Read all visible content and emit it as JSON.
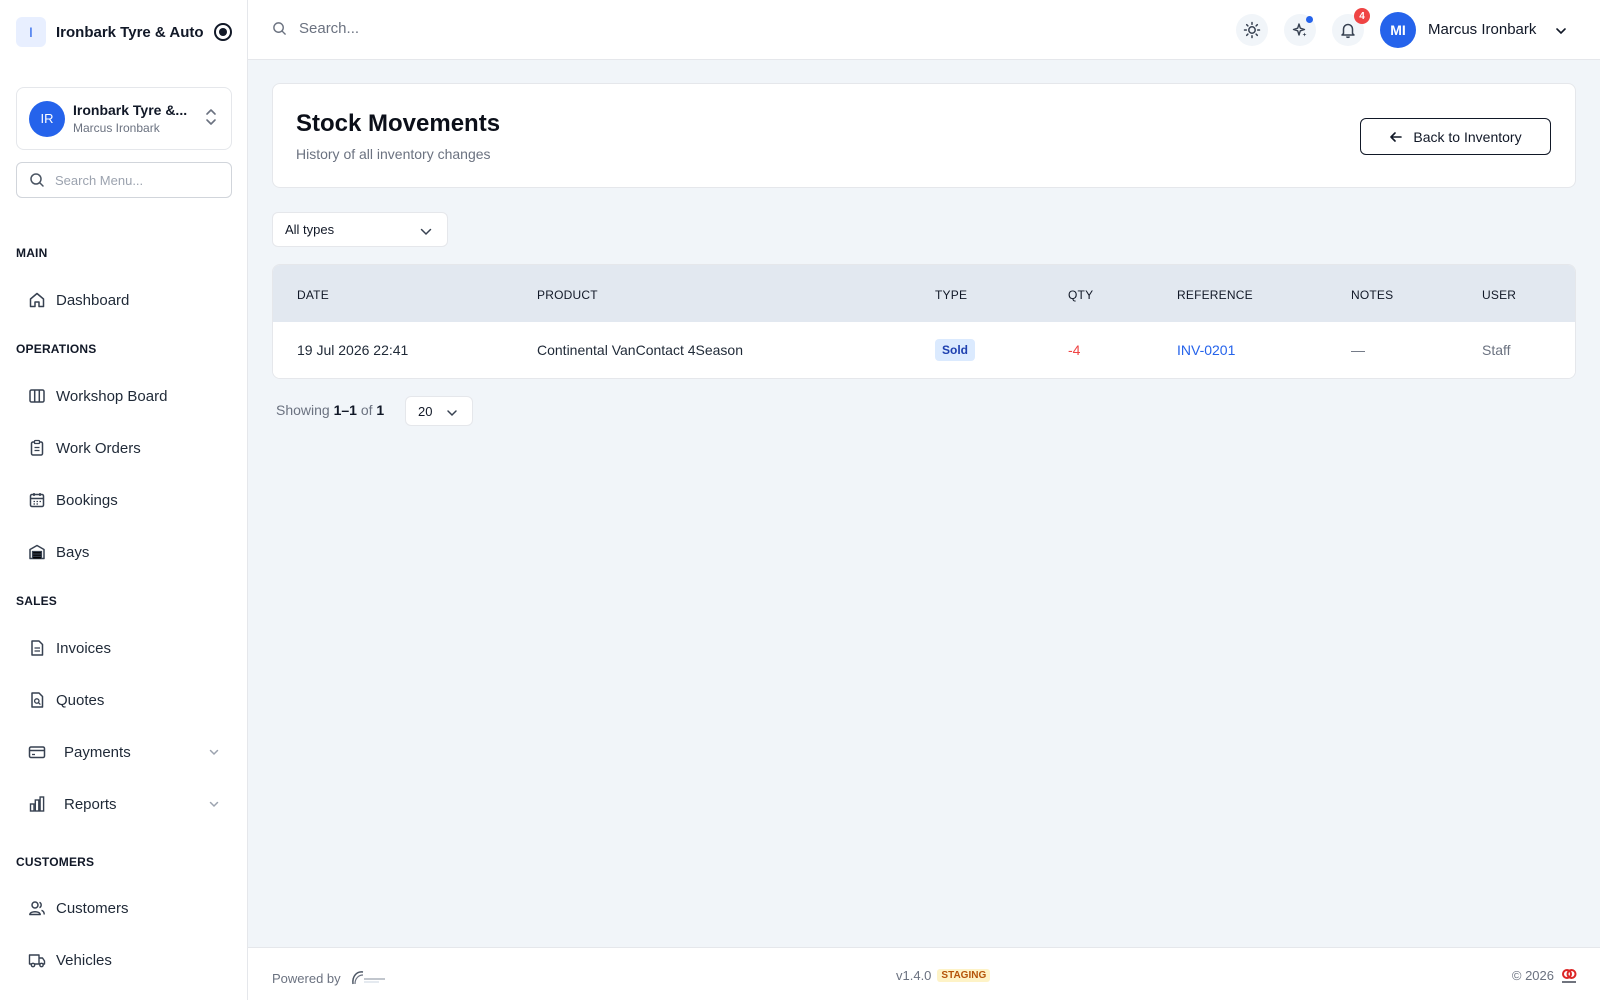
{
  "brand": {
    "logo_letter": "I",
    "name": "Ironbark Tyre & Auto"
  },
  "org": {
    "initials": "IR",
    "name": "Ironbark Tyre &...",
    "user": "Marcus Ironbark"
  },
  "menu_search": {
    "placeholder": "Search Menu..."
  },
  "sidebar": {
    "sections": [
      {
        "label": "MAIN",
        "items": [
          {
            "label": "Dashboard",
            "icon": "home-icon"
          }
        ]
      },
      {
        "label": "OPERATIONS",
        "items": [
          {
            "label": "Workshop Board",
            "icon": "columns-icon"
          },
          {
            "label": "Work Orders",
            "icon": "clipboard-icon"
          },
          {
            "label": "Bookings",
            "icon": "calendar-icon"
          },
          {
            "label": "Bays",
            "icon": "garage-icon"
          }
        ]
      },
      {
        "label": "SALES",
        "items": [
          {
            "label": "Invoices",
            "icon": "document-icon"
          },
          {
            "label": "Quotes",
            "icon": "document-search-icon"
          },
          {
            "label": "Payments",
            "icon": "credit-card-icon",
            "expandable": true
          },
          {
            "label": "Reports",
            "icon": "bar-chart-icon",
            "expandable": true
          }
        ]
      },
      {
        "label": "CUSTOMERS",
        "items": [
          {
            "label": "Customers",
            "icon": "users-icon"
          },
          {
            "label": "Vehicles",
            "icon": "truck-icon"
          }
        ]
      }
    ]
  },
  "topbar": {
    "search_placeholder": "Search...",
    "notification_count": "4",
    "user_initials": "MI",
    "user_name": "Marcus Ironbark"
  },
  "page": {
    "title": "Stock Movements",
    "subtitle": "History of all inventory changes",
    "back_label": "Back to Inventory"
  },
  "filter": {
    "selected": "All types"
  },
  "table": {
    "columns": [
      "DATE",
      "PRODUCT",
      "TYPE",
      "QTY",
      "REFERENCE",
      "NOTES",
      "USER"
    ],
    "rows": [
      {
        "date": "19 Jul 2026 22:41",
        "product": "Continental VanContact 4Season",
        "type": "Sold",
        "qty": "-4",
        "reference": "INV-0201",
        "notes": "—",
        "user": "Staff"
      }
    ]
  },
  "pagination": {
    "prefix": "Showing",
    "range": "1–1",
    "of": "of",
    "total": "1",
    "per_page": "20"
  },
  "footer": {
    "powered_by": "Powered by",
    "version": "v1.4.0",
    "env": "STAGING",
    "copyright": "© 2026"
  },
  "colors": {
    "accent": "#2563eb",
    "negative": "#ef4444",
    "badge_bg": "#dbeafe",
    "link": "#2563eb"
  }
}
